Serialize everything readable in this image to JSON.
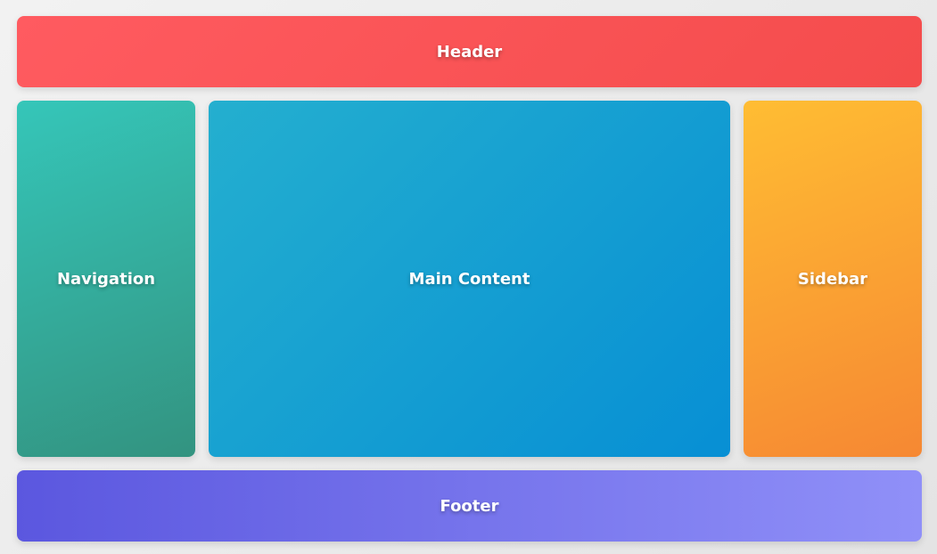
{
  "regions": {
    "header": "Header",
    "navigation": "Navigation",
    "main": "Main Content",
    "sidebar": "Sidebar",
    "footer": "Footer"
  },
  "colors": {
    "header": "#ff5b60",
    "navigation": "#35c6b9",
    "main": "#24afcf",
    "sidebar": "#ffbd33",
    "footer": "#5b57df"
  }
}
